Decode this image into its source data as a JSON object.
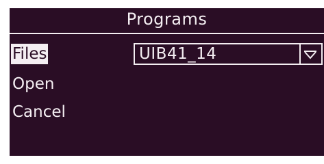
{
  "window": {
    "title": "Programs"
  },
  "menu": {
    "items": [
      {
        "label": "Files",
        "selected": true
      },
      {
        "label": "Open",
        "selected": false
      },
      {
        "label": "Cancel",
        "selected": false
      }
    ]
  },
  "program_select": {
    "value": "UIB41_14",
    "icon": "triangle-down-icon"
  },
  "colors": {
    "background": "#2a0d25",
    "foreground": "#f4eef2"
  }
}
